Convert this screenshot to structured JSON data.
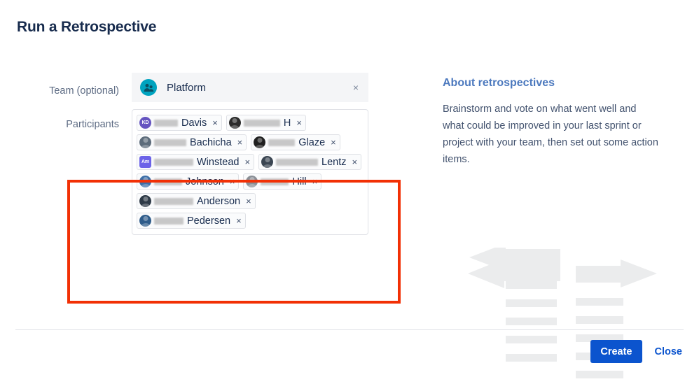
{
  "dialog": {
    "title": "Run a Retrospective"
  },
  "form": {
    "team": {
      "label": "Team (optional)",
      "value": "Platform",
      "avatar_icon": "team-people-icon",
      "avatar_color": "#00A3BF",
      "clear_icon": "×"
    },
    "participants": {
      "label": "Participants",
      "remove_icon": "×",
      "chips": [
        {
          "name": "Davis",
          "redacted_width": 34,
          "avatar_type": "initials",
          "initials": "KD",
          "avatar_color": "#6554C0"
        },
        {
          "name": "H",
          "redacted_width": 52,
          "avatar_type": "photo",
          "initials": "",
          "avatar_color": "#2C2C2C"
        },
        {
          "name": "Bachicha",
          "redacted_width": 46,
          "avatar_type": "photo",
          "initials": "",
          "avatar_color": "#5C6B7A"
        },
        {
          "name": "Glaze",
          "redacted_width": 38,
          "avatar_type": "photo",
          "initials": "",
          "avatar_color": "#1F1F1F"
        },
        {
          "name": "Winstead",
          "redacted_width": 56,
          "avatar_type": "initials",
          "initials": "Am",
          "avatar_color": "#6C63E8"
        },
        {
          "name": "Lentz",
          "redacted_width": 60,
          "avatar_type": "photo",
          "initials": "",
          "avatar_color": "#3B4652"
        },
        {
          "name": "Johnson",
          "redacted_width": 40,
          "avatar_type": "photo",
          "initials": "",
          "avatar_color": "#3D6FA8"
        },
        {
          "name": "Hill",
          "redacted_width": 40,
          "avatar_type": "photo",
          "initials": "",
          "avatar_color": "#8A8F96"
        },
        {
          "name": "Anderson",
          "redacted_width": 56,
          "avatar_type": "photo",
          "initials": "",
          "avatar_color": "#2E3A47"
        },
        {
          "name": "Pedersen",
          "redacted_width": 42,
          "avatar_type": "photo",
          "initials": "",
          "avatar_color": "#2F5C8A"
        }
      ]
    }
  },
  "info": {
    "title": "About retrospectives",
    "text": "Brainstorm and vote on what went well and what could be improved in your last sprint or project with your team, then set out some action items.",
    "illustration_icon": "retrospective-arrows-illustration"
  },
  "footer": {
    "create_label": "Create",
    "close_label": "Close",
    "create_color": "#0B54CE"
  },
  "annotation": {
    "color": "#F23005",
    "target": "participants-field"
  }
}
